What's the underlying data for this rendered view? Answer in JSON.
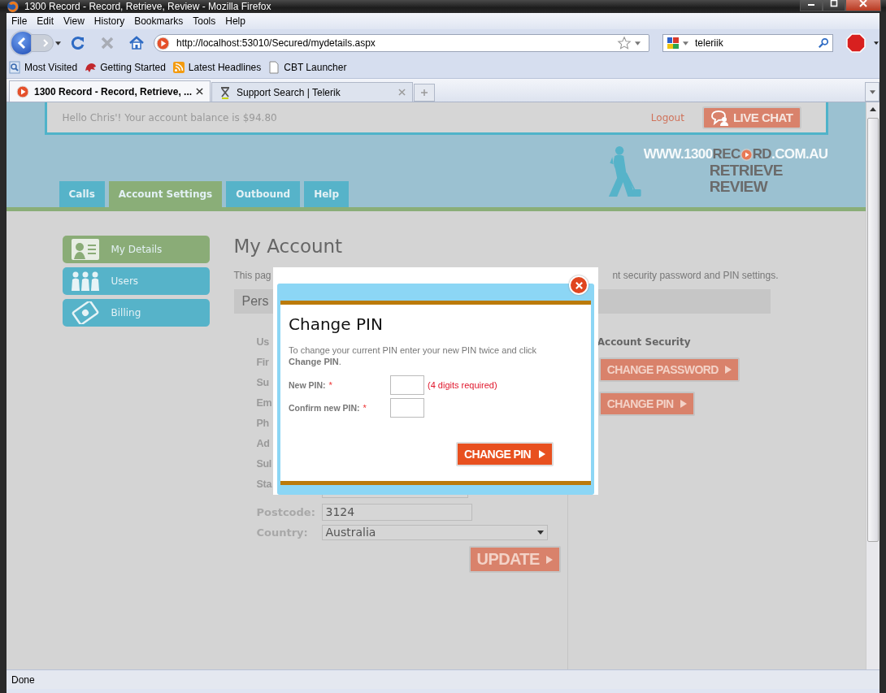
{
  "window": {
    "title": "1300 Record - Record, Retrieve, Review - Mozilla Firefox"
  },
  "menu": [
    "File",
    "Edit",
    "View",
    "History",
    "Bookmarks",
    "Tools",
    "Help"
  ],
  "address_bar": {
    "value": "http://localhost:53010/Secured/mydetails.aspx"
  },
  "search": {
    "value": "teleriik"
  },
  "bookmarks": [
    {
      "label": "Most Visited",
      "kind": "smart"
    },
    {
      "label": "Getting Started",
      "kind": "dino"
    },
    {
      "label": "Latest Headlines",
      "kind": "feed"
    },
    {
      "label": "CBT Launcher",
      "kind": "page"
    }
  ],
  "tabs": [
    {
      "label": "1300 Record - Record, Retrieve, ...",
      "selected": true,
      "kind": "record"
    },
    {
      "label": "Support Search | Telerik",
      "selected": false,
      "kind": "telerik"
    }
  ],
  "page": {
    "greeting": "Hello Chris'! Your account balance is $94.80",
    "logout": "Logout",
    "live_chat": "LIVE CHAT",
    "logo": {
      "parts": [
        {
          "text": "WWW.1300",
          "kind": "light"
        },
        {
          "text": "REC",
          "kind": "dark"
        },
        {
          "text": "RD",
          "kind": "dark"
        },
        {
          "text": ".COM.AU",
          "kind": "light"
        }
      ],
      "lines": [
        "RETRIEVE",
        "REVIEW"
      ]
    },
    "nav_tabs": [
      {
        "label": "Calls",
        "selected": false
      },
      {
        "label": "Account Settings",
        "selected": true
      },
      {
        "label": "Outbound",
        "selected": false
      },
      {
        "label": "Help",
        "selected": false
      }
    ],
    "sidebar": [
      {
        "label": "My Details",
        "selected": true,
        "kind": "card"
      },
      {
        "label": "Users",
        "selected": false,
        "kind": "users"
      },
      {
        "label": "Billing",
        "selected": false,
        "kind": "billing"
      }
    ],
    "heading": "My Account",
    "intro_start": "This pag",
    "intro_end": "nt security password and PIN settings.",
    "section": "Pers",
    "form_labels": [
      "Us",
      "Fir",
      "Su",
      "Em",
      "Ph",
      "Ad",
      "Sul",
      "Sta"
    ],
    "postcode": {
      "label": "Postcode:",
      "value": "3124"
    },
    "country": {
      "label": "Country:",
      "value": "Australia"
    },
    "update": "UPDATE",
    "security": {
      "title": "Account Security",
      "buttons": [
        "CHANGE PASSWORD",
        "CHANGE PIN"
      ]
    }
  },
  "dialog": {
    "title": "Change PIN",
    "instructions": "To change your current PIN enter your new PIN twice and click **Change PIN**.",
    "fields": [
      {
        "label": "New PIN:",
        "required_mark": "*",
        "hint": "(4 digits required)"
      },
      {
        "label": "Confirm new PIN:",
        "required_mark": "*"
      }
    ],
    "button": "CHANGE PIN"
  },
  "status_bar": "Done"
}
